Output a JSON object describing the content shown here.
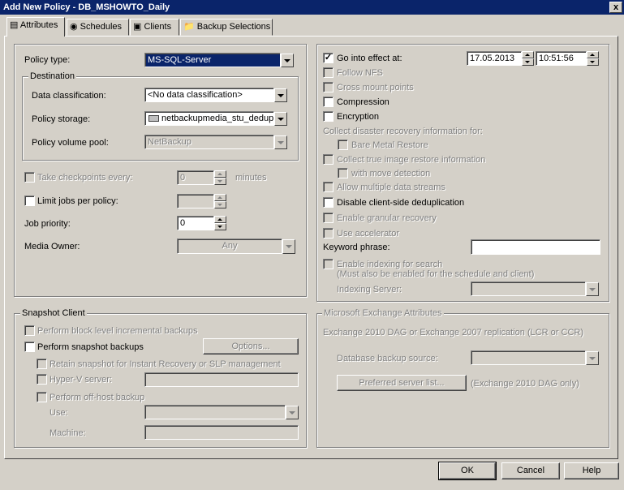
{
  "window": {
    "title": "Add New Policy - DB_MSHOWTO_Daily",
    "close": "x"
  },
  "tabs": [
    "Attributes",
    "Schedules",
    "Clients",
    "Backup Selections"
  ],
  "left": {
    "policy_type_label": "Policy type:",
    "policy_type_value": "MS-SQL-Server",
    "destination_label": "Destination",
    "data_class_label": "Data classification:",
    "data_class_value": "<No data classification>",
    "policy_storage_label": "Policy storage:",
    "policy_storage_value": "netbackupmedia_stu_dedup_c",
    "volume_pool_label": "Policy volume pool:",
    "volume_pool_value": "NetBackup",
    "checkpoints_label": "Take checkpoints every:",
    "checkpoints_value": "0",
    "minutes_label": "minutes",
    "limit_jobs_label": "Limit jobs per policy:",
    "job_priority_label": "Job priority:",
    "job_priority_value": "0",
    "media_owner_label": "Media Owner:",
    "media_owner_value": "Any"
  },
  "right": {
    "go_into_effect_label": "Go into effect at:",
    "date_value": "17.05.2013",
    "time_value": "10:51:56",
    "follow_nfs": "Follow NFS",
    "cross_mount": "Cross mount points",
    "compression": "Compression",
    "encryption": "Encryption",
    "collect_dr_label": "Collect disaster recovery information for:",
    "bare_metal": "Bare Metal Restore",
    "collect_tir": "Collect true image restore information",
    "with_move": "with move detection",
    "allow_multiple": "Allow multiple data streams",
    "disable_dedup": "Disable client-side deduplication",
    "granular": "Enable granular recovery",
    "accelerator": "Use accelerator",
    "keyword_label": "Keyword phrase:",
    "keyword_value": "",
    "indexing": "Enable indexing for search",
    "indexing_note": "(Must also be enabled for the schedule and client)",
    "indexing_server_label": "Indexing Server:"
  },
  "snapshot": {
    "title": "Snapshot Client",
    "block_level": "Perform block level incremental backups",
    "perform_snapshot": "Perform snapshot backups",
    "options_button": "Options...",
    "retain": "Retain snapshot for Instant Recovery or SLP management",
    "hyperv": "Hyper-V server:",
    "offhost": "Perform off-host backup",
    "use_label": "Use:",
    "machine_label": "Machine:"
  },
  "exchange": {
    "title": "Microsoft Exchange Attributes",
    "replication": "Exchange 2010 DAG or Exchange 2007 replication (LCR or CCR)",
    "db_source_label": "Database backup source:",
    "preferred_button": "Preferred server list...",
    "dag_only": "(Exchange 2010 DAG only)"
  },
  "buttons": {
    "ok": "OK",
    "cancel": "Cancel",
    "help": "Help"
  }
}
